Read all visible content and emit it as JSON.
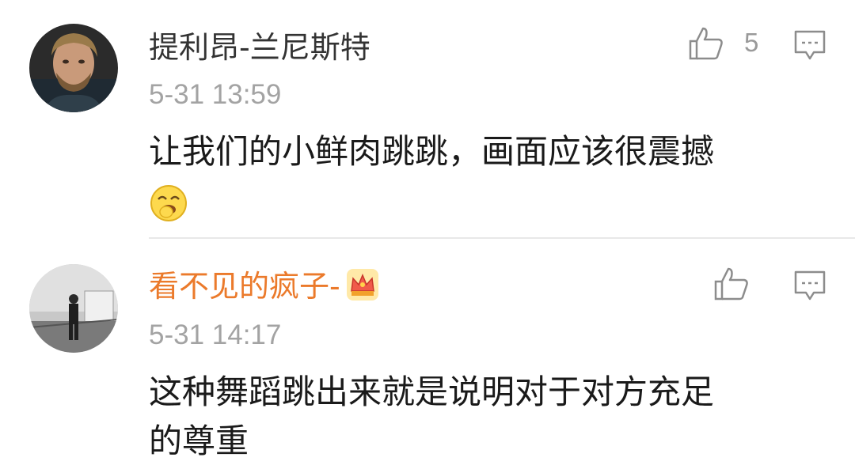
{
  "colors": {
    "name_default": "#333333",
    "name_vip": "#eb7a2b",
    "timestamp": "#a3a3a3",
    "icon": "#8c8c8c"
  },
  "comments": [
    {
      "username": "提利昂-兰尼斯特",
      "timestamp": "5-31 13:59",
      "like_count": "5",
      "text_lines": [
        "让我们的小鲜肉跳跳，画面应该很震撼"
      ],
      "emoji": "laughing-face-emoji",
      "vip": false
    },
    {
      "username": "看不见的疯子-",
      "timestamp": "5-31 14:17",
      "like_count": "",
      "text_lines": [
        "这种舞蹈跳出来就是说明对于对方充足",
        "的尊重"
      ],
      "vip": true,
      "vip_badge": "crown-badge-icon"
    }
  ],
  "icons": {
    "like": "thumbs-up-icon",
    "reply": "comment-bubble-icon"
  }
}
